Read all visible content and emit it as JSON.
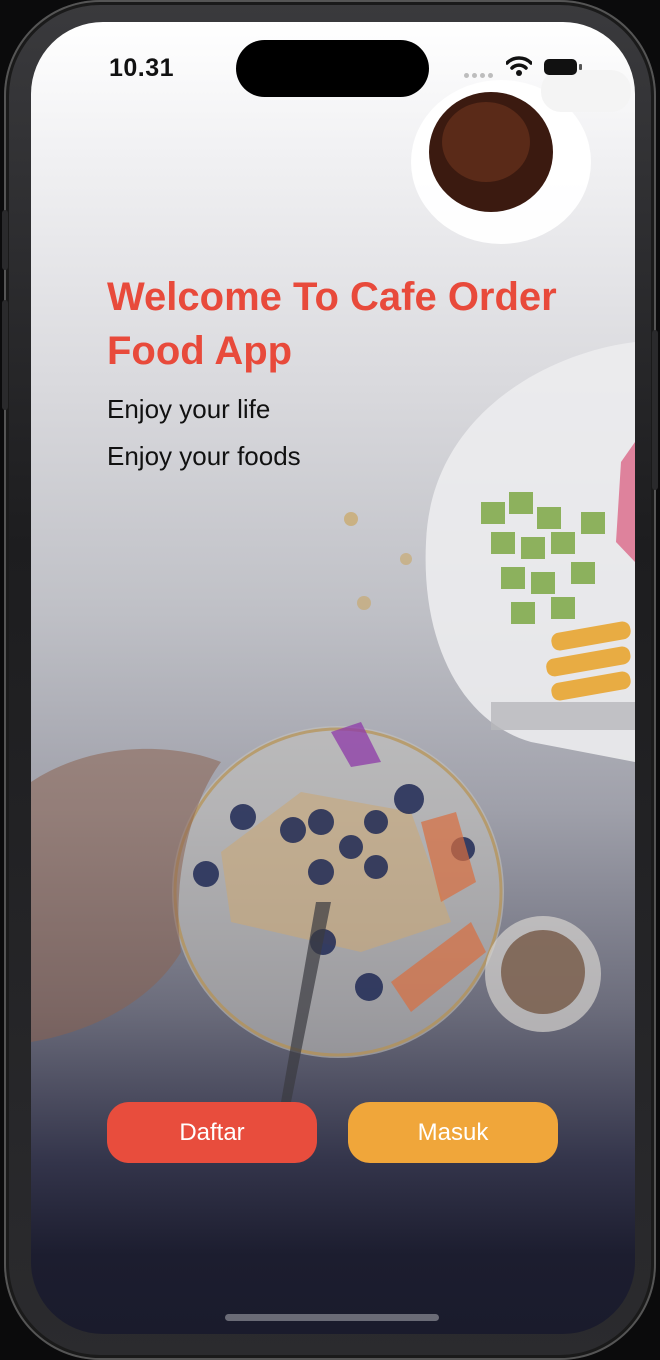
{
  "status_bar": {
    "time": "10.31"
  },
  "welcome": {
    "title": "Welcome To Cafe Order Food App",
    "line1": "Enjoy your life",
    "line2": "Enjoy your foods"
  },
  "buttons": {
    "register_label": "Daftar",
    "login_label": "Masuk"
  },
  "colors": {
    "accent_red": "#e84d3d",
    "accent_orange": "#f0a63a",
    "title_red": "#e84a3b"
  }
}
